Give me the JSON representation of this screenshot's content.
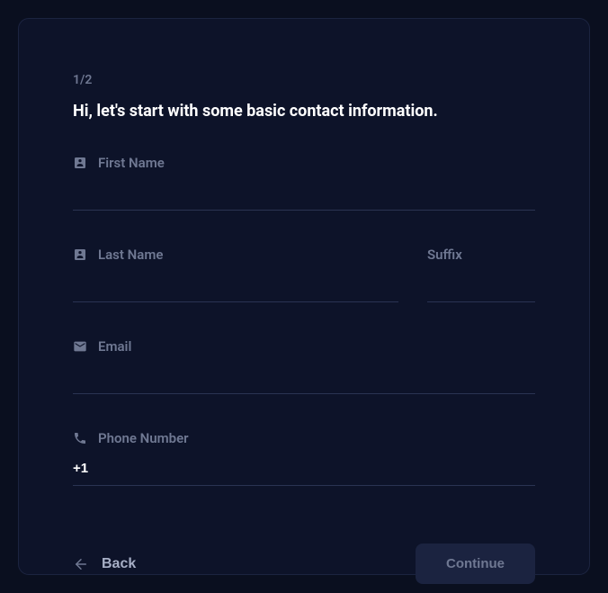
{
  "step_indicator": "1/2",
  "heading": "Hi, let's start with some basic contact information.",
  "fields": {
    "first_name": {
      "label": "First Name",
      "value": ""
    },
    "last_name": {
      "label": "Last Name",
      "value": ""
    },
    "suffix": {
      "label": "Suffix",
      "value": ""
    },
    "email": {
      "label": "Email",
      "value": ""
    },
    "phone": {
      "label": "Phone Number",
      "value": "+1"
    }
  },
  "buttons": {
    "back": "Back",
    "continue": "Continue"
  }
}
